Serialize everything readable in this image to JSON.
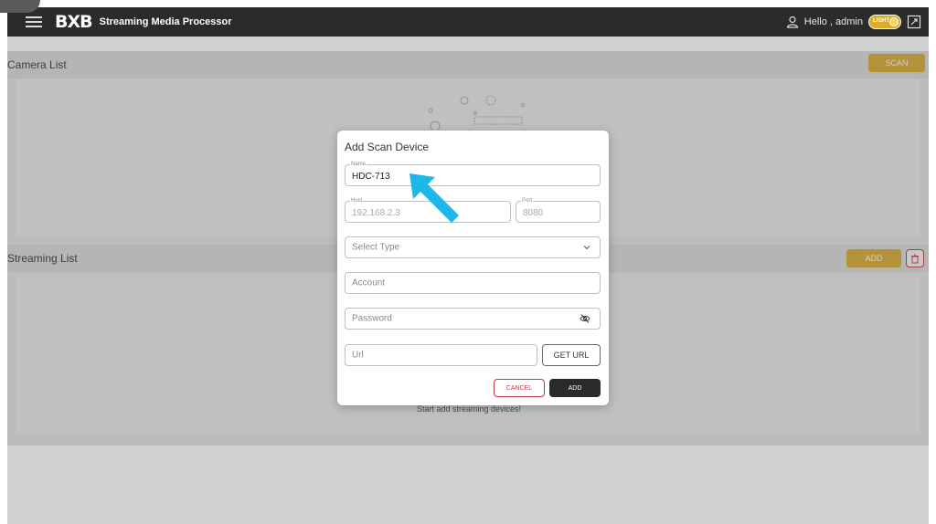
{
  "topbar": {
    "logo": "BXB",
    "app_title": "Streaming Media Processor",
    "greeting": "Hello , admin",
    "theme_label": "LIGHT"
  },
  "camera_section": {
    "title": "Camera List",
    "scan_label": "SCAN"
  },
  "streaming_section": {
    "title": "Streaming List",
    "add_label": "ADD",
    "empty_message": "Start add streaming devices!"
  },
  "modal": {
    "title": "Add Scan Device",
    "name_label": "Name",
    "name_value": "HDC-713",
    "host_label": "Host",
    "host_value": "192.168.2.3",
    "port_label": "Port",
    "port_value": "8080",
    "type_placeholder": "Select Type",
    "account_placeholder": "Account",
    "password_placeholder": "Password",
    "url_placeholder": "Url",
    "get_url_label": "GET URL",
    "cancel_label": "CANCEL",
    "add_label": "ADD"
  },
  "colors": {
    "accent": "#d6a82e",
    "topbar": "#2b2b2b",
    "cancel": "#c0394b",
    "pointer": "#1db8e8"
  }
}
